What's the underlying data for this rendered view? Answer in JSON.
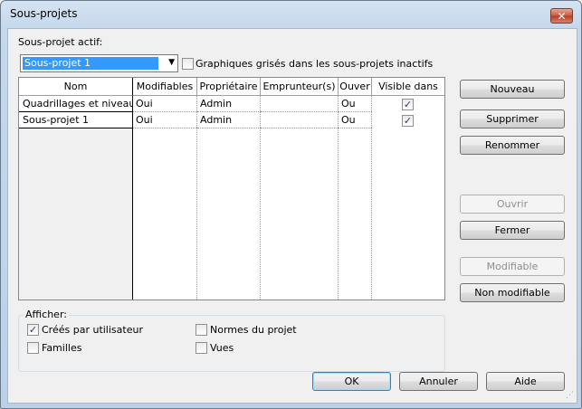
{
  "window": {
    "title": "Sous-projets",
    "close_glyph": "✕"
  },
  "active": {
    "label": "Sous-projet actif:",
    "value": "Sous-projet 1",
    "arrow": "▼"
  },
  "gray_checkbox": {
    "label": "Graphiques grisés dans les sous-projets inactifs",
    "checked": false
  },
  "table": {
    "headers": [
      "Nom",
      "Modifiables",
      "Propriétaire",
      "Emprunteur(s)",
      "Ouver",
      "Visible dans"
    ],
    "rows": [
      {
        "name": "Quadrillages et niveau",
        "editable": "Oui",
        "owner": "Admin",
        "borrowers": "",
        "open": "Ou",
        "visible": true
      },
      {
        "name": "Sous-projet 1",
        "editable": "Oui",
        "owner": "Admin",
        "borrowers": "",
        "open": "Ou",
        "visible": true
      }
    ]
  },
  "side_buttons": {
    "new": "Nouveau",
    "delete": "Supprimer",
    "rename": "Renommer",
    "open": "Ouvrir",
    "close": "Fermer",
    "editable": "Modifiable",
    "not_editable": "Non modifiable"
  },
  "show": {
    "label": "Afficher:",
    "user_created": {
      "label": "Créés par utilisateur",
      "checked": true
    },
    "families": {
      "label": "Familles",
      "checked": false
    },
    "project_standards": {
      "label": "Normes du projet",
      "checked": false
    },
    "views": {
      "label": "Vues",
      "checked": false
    }
  },
  "footer": {
    "ok": "OK",
    "cancel": "Annuler",
    "help": "Aide"
  },
  "check_glyph": "✓"
}
